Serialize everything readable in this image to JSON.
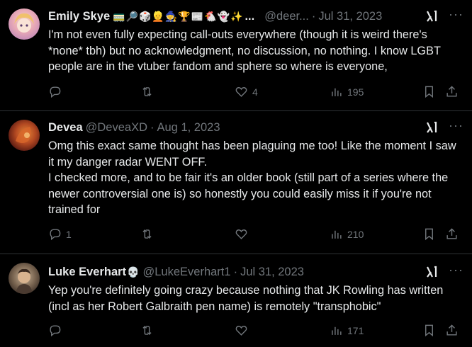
{
  "tweets": [
    {
      "name": "Emily Skye",
      "emojis": "🚃🔎🎲👱🧙🏆📰🐔👻✨",
      "ellipsis": "...",
      "handle": "@deer...",
      "sep": "·",
      "date": "Jul 31, 2023",
      "text": "I'm not even fully expecting call-outs everywhere (though it is weird there's *none* tbh) but no acknowledgment, no discussion, no nothing. I know LGBT people are in the vtuber fandom and sphere so where is everyone,",
      "replies": "",
      "retweets": "",
      "likes": "4",
      "views": "195"
    },
    {
      "name": "Devea",
      "emojis": "",
      "ellipsis": "",
      "handle": "@DeveaXD",
      "sep": "·",
      "date": "Aug 1, 2023",
      "text": "Omg this exact same thought has been plaguing me too! Like the moment I saw it my danger radar WENT OFF.\nI checked more, and to be fair it's an older book (still part of a series where the newer controversial one is) so honestly you could easily miss it if you're not trained for",
      "replies": "1",
      "retweets": "",
      "likes": "",
      "views": "210"
    },
    {
      "name": "Luke Everhart",
      "emojis": "💀",
      "ellipsis": "",
      "handle": "@LukeEverhart1",
      "sep": "·",
      "date": "Jul 31, 2023",
      "text": "Yep you're definitely going crazy because nothing that JK Rowling has written (incl as her Robert Galbraith pen name) is remotely \"transphobic\"",
      "replies": "",
      "retweets": "",
      "likes": "",
      "views": "171"
    }
  ],
  "icons": {
    "reply": "reply-icon",
    "retweet": "retweet-icon",
    "like": "heart-icon",
    "views": "views-icon",
    "bookmark": "bookmark-icon",
    "share": "share-icon",
    "grok": "grok-icon",
    "more": "more-icon"
  },
  "colors": {
    "background": "#000000",
    "text": "#e7e9ea",
    "muted": "#71767b",
    "divider": "#2f3336"
  }
}
